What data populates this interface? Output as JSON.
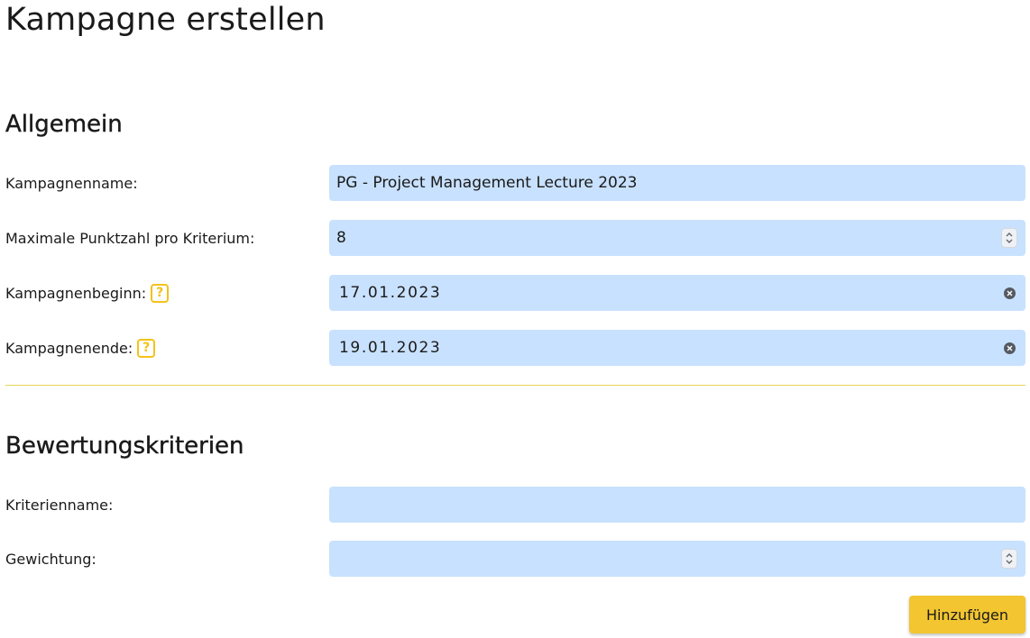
{
  "page": {
    "title": "Kampagne erstellen"
  },
  "general": {
    "heading": "Allgemein",
    "campaign_name": {
      "label": "Kampagnenname:",
      "value": "PG - Project Management Lecture 2023"
    },
    "max_points": {
      "label": "Maximale Punktzahl pro Kriterium:",
      "value": "8"
    },
    "start": {
      "label": "Kampagnenbeginn:",
      "help": "?",
      "value": "17.01.2023"
    },
    "end": {
      "label": "Kampagnenende:",
      "help": "?",
      "value": "19.01.2023"
    }
  },
  "criteria": {
    "heading": "Bewertungskriterien",
    "name": {
      "label": "Kriterienname:",
      "value": ""
    },
    "weight": {
      "label": "Gewichtung:",
      "value": ""
    },
    "add_button": "Hinzufügen"
  },
  "colors": {
    "input_bg": "#c8e1fe",
    "accent": "#f2c531",
    "divider": "#e6d55a"
  }
}
